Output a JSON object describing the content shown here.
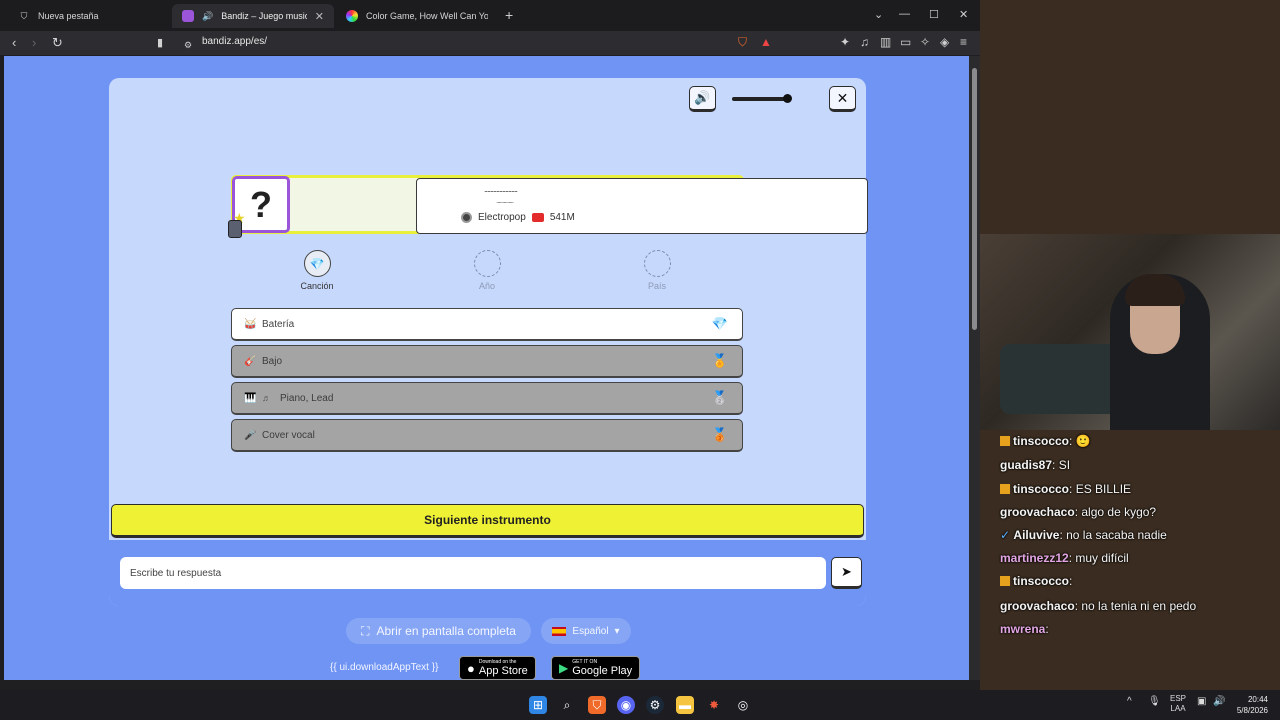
{
  "browser": {
    "tabs": [
      {
        "title": "Nueva pestaña"
      },
      {
        "title": "Bandiz – Juego musical diario"
      },
      {
        "title": "Color Game, How Well Can You Remember Colors"
      }
    ],
    "url": "bandiz.app/es/"
  },
  "game": {
    "song": {
      "title_hidden": "......................",
      "artist_hidden": "..............",
      "genre": "Electropop",
      "views": "541M",
      "unknown_symbol": "?"
    },
    "steps": [
      {
        "label": "Canción"
      },
      {
        "label": "Año"
      },
      {
        "label": "País"
      }
    ],
    "instruments": [
      {
        "label": "Batería",
        "icon": "drum-icon"
      },
      {
        "label": "Bajo",
        "icon": "guitar-icon"
      },
      {
        "label": "Piano, Lead",
        "icon": "piano-icon"
      },
      {
        "label": "Cover vocal",
        "icon": "microphone-icon"
      }
    ],
    "next_button": "Siguiente instrumento",
    "answer_placeholder": "Escribe tu respuesta",
    "fullscreen_button": "Abrir en pantalla completa",
    "language": "Español",
    "download_text": "{{ ui.downloadAppText }}",
    "app_store": {
      "small": "Download on the",
      "big": "App Store"
    },
    "google_play": {
      "small": "GET IT ON",
      "big": "Google Play"
    }
  },
  "chat": [
    {
      "user": "tinscocco",
      "text": "🙂",
      "color": "#f0f0f0",
      "badge": true
    },
    {
      "user": "guadis87",
      "text": "SI",
      "color": "#f0f0f0",
      "badge": false
    },
    {
      "user": "tinscocco",
      "text": "ES BILLIE",
      "color": "#f0f0f0",
      "badge": true
    },
    {
      "user": "groovachaco",
      "text": "algo de kygo?",
      "color": "#f0f0f0",
      "badge": false
    },
    {
      "user": "Ailuvive",
      "text": "no la sacaba nadie",
      "color": "#f0f0f0",
      "badge": false
    },
    {
      "user": "martinezz12",
      "text": "muy difícil",
      "color": "#d89ad8",
      "badge": false
    },
    {
      "user": "tinscocco",
      "text": "",
      "color": "#f0f0f0",
      "badge": true
    },
    {
      "user": "groovachaco",
      "text": "no la tenia ni en pedo",
      "color": "#f0f0f0",
      "badge": false
    },
    {
      "user": "mwrena",
      "text": "",
      "color": "#d89ad8",
      "badge": false
    }
  ],
  "taskbar": {
    "lang_top": "ESP",
    "lang_bottom": "LAA",
    "time": "20:44",
    "date": "5/8/2026"
  }
}
